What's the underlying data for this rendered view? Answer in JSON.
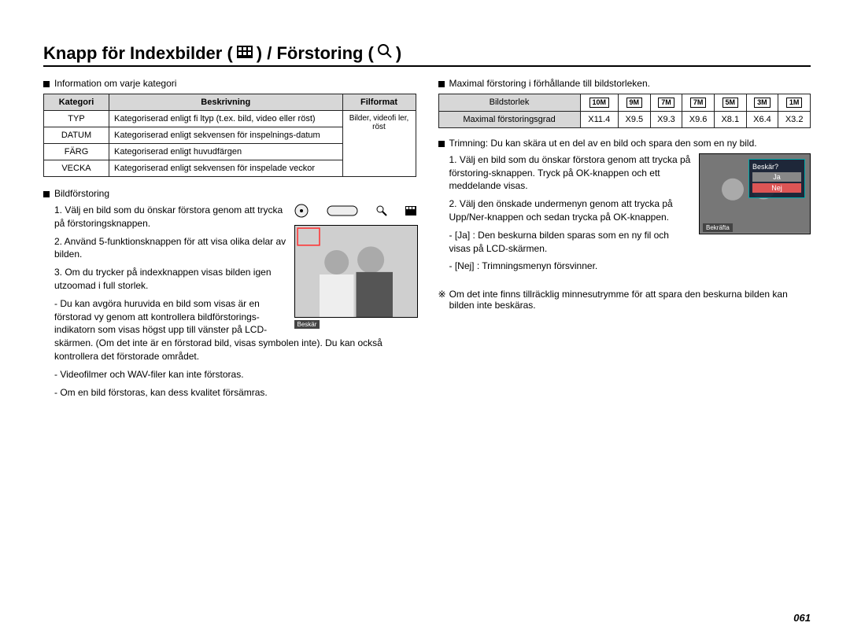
{
  "title_pre": "Knapp för Indexbilder (",
  "title_mid": ") / Förstoring (",
  "title_post": ")",
  "page_number": "061",
  "left": {
    "heading1": "Information om varje kategori",
    "table_head": {
      "c1": "Kategori",
      "c2": "Beskrivning",
      "c3": "Filformat"
    },
    "rows": [
      {
        "k": "TYP",
        "d": "Kategoriserad enligt fi ltyp (t.ex. bild, video eller röst)"
      },
      {
        "k": "DATUM",
        "d": "Kategoriserad enligt sekvensen för inspelnings-datum"
      },
      {
        "k": "FÄRG",
        "d": "Kategoriserad enligt huvudfärgen"
      },
      {
        "k": "VECKA",
        "d": "Kategoriserad enligt sekvensen för inspelade veckor"
      }
    ],
    "format_cell": "Bilder, videofi ler, röst",
    "heading2": "Bildförstoring",
    "step1": "1. Välj en bild som du önskar förstora genom att trycka på förstoringsknappen.",
    "step2": "2. Använd 5-funktionsknappen för att visa olika delar av bilden.",
    "step3": "3. Om du trycker på indexknappen visas bilden igen utzoomad i full storlek.",
    "sub1": "- Du kan avgöra huruvida en bild som visas är en förstorad vy genom att kontrollera bildförstorings-indikatorn som visas högst upp till vänster på LCD-skärmen. (Om det inte är en förstorad bild, visas symbolen inte). Du kan också kontrollera det förstorade området.",
    "sub2": "- Videofilmer och WAV-filer kan inte förstoras.",
    "sub3": "- Om en bild förstoras, kan dess kvalitet försämras.",
    "caption": "Beskär"
  },
  "right": {
    "heading1": "Maximal förstoring i förhållande till bildstorleken.",
    "zoom_row1_label": "Bildstorlek",
    "sizes": [
      "10M",
      "9M",
      "7M",
      "7M",
      "5M",
      "3M",
      "1M"
    ],
    "zoom_row2_label": "Maximal förstoringsgrad",
    "zooms": [
      "X11.4",
      "X9.5",
      "X9.3",
      "X9.6",
      "X8.1",
      "X6.4",
      "X3.2"
    ],
    "heading2": "Trimning: Du kan skära ut en del av en bild och spara den som en ny bild.",
    "step1": "1. Välj en bild som du önskar förstora genom att trycka på förstoring-sknappen. Tryck på OK-knappen och ett meddelande visas.",
    "step2": "2. Välj den önskade undermenyn genom att trycka på Upp/Ner-knappen och sedan trycka på OK-knappen.",
    "optJa": "- [Ja]  : Den beskurna bilden sparas som en ny fil och visas på LCD-skärmen.",
    "optNej": "- [Nej] : Trimningsmenyn försvinner.",
    "note": "Om det inte finns tillräcklig minnesutrymme för att spara den beskurna bilden kan bilden inte beskäras.",
    "dialog_q": "Beskär?",
    "dialog_ja": "Ja",
    "dialog_nej": "Nej",
    "dialog_ok": "Bekräfta"
  }
}
